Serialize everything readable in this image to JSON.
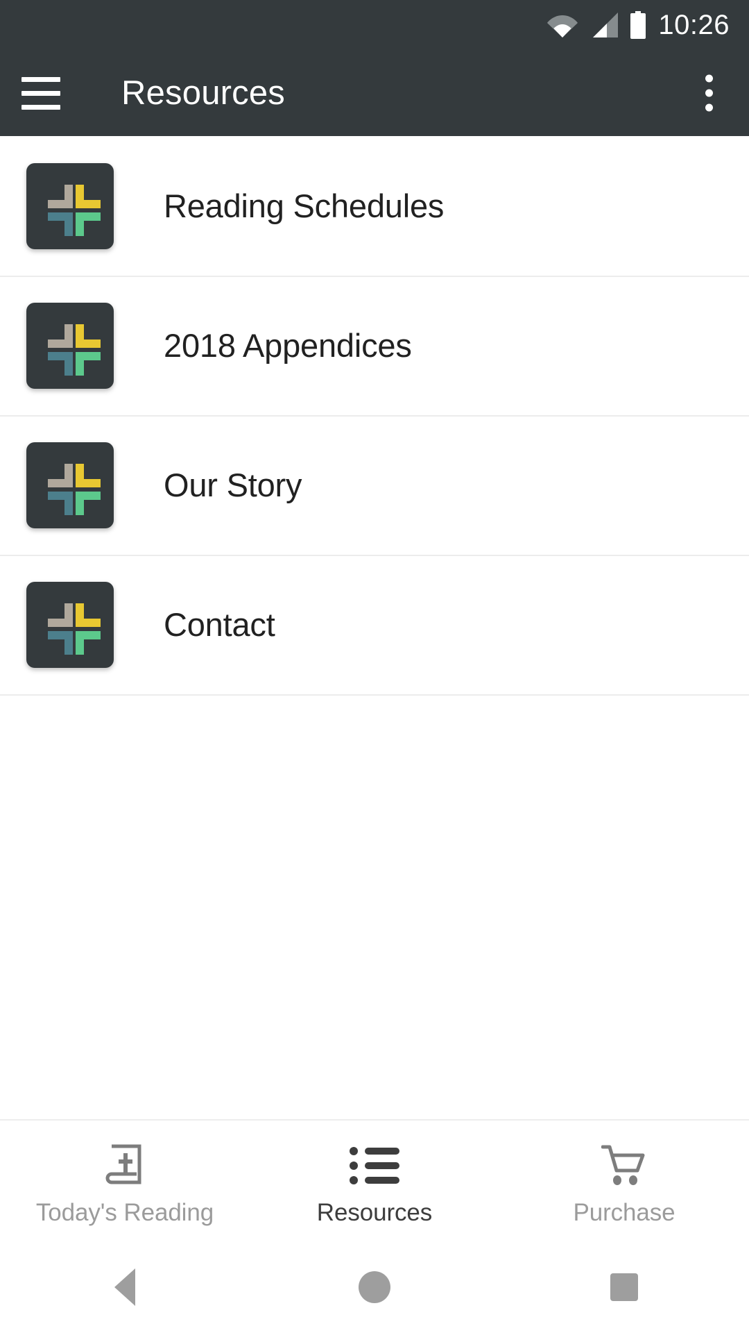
{
  "status_bar": {
    "time": "10:26",
    "icons": [
      "wifi-icon",
      "cellular-signal-icon",
      "battery-icon"
    ]
  },
  "app_bar": {
    "menu_icon": "hamburger-menu-icon",
    "title": "Resources",
    "overflow_icon": "overflow-menu-icon"
  },
  "colors": {
    "app_bar_bg": "#343a3d",
    "icon_bg": "#343a3d",
    "icon_tan": "#b0a89c",
    "icon_yellow": "#e8c832",
    "icon_teal": "#4c7f8c",
    "icon_green": "#5cc98c",
    "text_primary": "#212121",
    "divider": "#ececec",
    "tab_active": "#3d3d3d",
    "tab_inactive": "#9b9b9b"
  },
  "list": {
    "items": [
      {
        "label": "Reading Schedules",
        "icon": "app-logo-icon"
      },
      {
        "label": "2018 Appendices",
        "icon": "app-logo-icon"
      },
      {
        "label": "Our Story",
        "icon": "app-logo-icon"
      },
      {
        "label": "Contact",
        "icon": "app-logo-icon"
      }
    ]
  },
  "bottom_nav": {
    "tabs": [
      {
        "label": "Today's Reading",
        "icon": "bible-book-icon",
        "active": false
      },
      {
        "label": "Resources",
        "icon": "bulleted-list-icon",
        "active": true
      },
      {
        "label": "Purchase",
        "icon": "shopping-cart-icon",
        "active": false
      }
    ]
  },
  "system_nav": {
    "back": "back-triangle-icon",
    "home": "home-circle-icon",
    "recents": "recents-square-icon"
  }
}
